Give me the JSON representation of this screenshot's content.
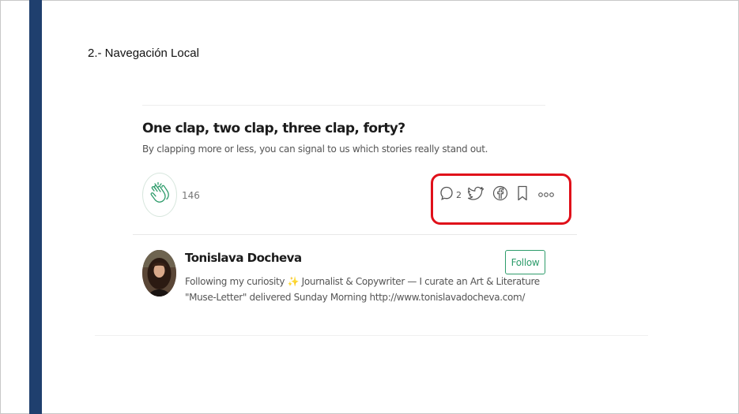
{
  "slide": {
    "title": "2.- Navegación Local"
  },
  "article": {
    "title": "One clap, two clap, three clap, forty?",
    "subtitle": "By clapping more or less, you can signal to us which stories really stand out.",
    "clap_count": "146",
    "response_count": "2",
    "icons": [
      "clap-icon",
      "comment-icon",
      "twitter-icon",
      "facebook-icon",
      "bookmark-icon",
      "more-icon"
    ]
  },
  "author": {
    "name": "Tonislava Docheva",
    "bio_line1": "Following my curiosity ✨ Journalist & Copywriter — I curate an Art & Literature",
    "bio_line2": "\"Muse-Letter\" delivered Sunday Morning http://www.tonislavadocheva.com/",
    "follow_label": "Follow"
  },
  "colors": {
    "sidebar": "#1f3f6e",
    "highlight": "#e0101a",
    "accent_green": "#2e9c6b"
  }
}
